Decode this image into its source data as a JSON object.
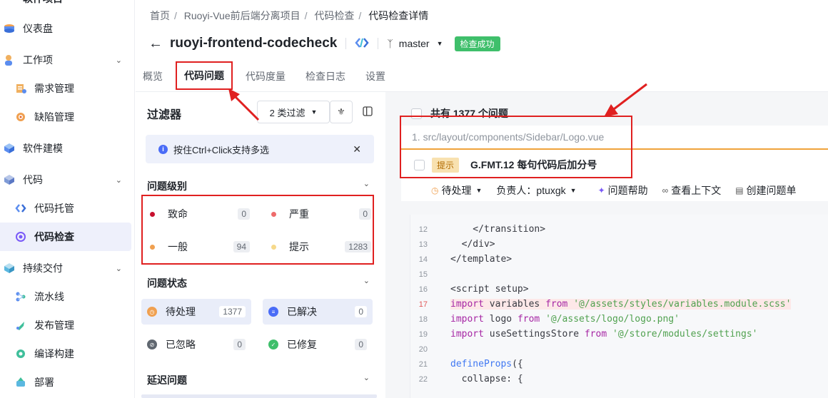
{
  "sidebar": {
    "top_partial": "软件项目",
    "items": [
      {
        "label": "仪表盘",
        "icon": "dashboard-icon"
      },
      {
        "label": "工作项",
        "icon": "workitem-icon"
      },
      {
        "label": "需求管理",
        "icon": "requirement-icon"
      },
      {
        "label": "缺陷管理",
        "icon": "bug-icon"
      },
      {
        "label": "软件建模",
        "icon": "model-icon"
      },
      {
        "label": "代码",
        "icon": "code-icon"
      },
      {
        "label": "代码托管",
        "icon": "repo-icon"
      },
      {
        "label": "代码检查",
        "icon": "codecheck-icon"
      },
      {
        "label": "持续交付",
        "icon": "delivery-icon"
      },
      {
        "label": "流水线",
        "icon": "pipeline-icon"
      },
      {
        "label": "发布管理",
        "icon": "release-icon"
      },
      {
        "label": "编译构建",
        "icon": "build-icon"
      },
      {
        "label": "部署",
        "icon": "deploy-icon"
      }
    ]
  },
  "breadcrumb": [
    "首页",
    "Ruoyi-Vue前后端分离项目",
    "代码检查",
    "代码检查详情"
  ],
  "header": {
    "project_name": "ruoyi-frontend-codecheck",
    "branch": "master",
    "status_badge": "检查成功"
  },
  "tabs": [
    "概览",
    "代码问题",
    "代码度量",
    "检查日志",
    "设置"
  ],
  "filter": {
    "title": "过滤器",
    "filter_button": "2 类过滤",
    "tip": "按住Ctrl+Click支持多选",
    "level_section": "问题级别",
    "levels": [
      {
        "label": "致命",
        "count": "0",
        "color": "#c8102e"
      },
      {
        "label": "严重",
        "count": "0",
        "color": "#ee6b6b"
      },
      {
        "label": "一般",
        "count": "94",
        "color": "#f0a050"
      },
      {
        "label": "提示",
        "count": "1283",
        "color": "#f6d98b"
      }
    ],
    "status_section": "问题状态",
    "statuses": [
      {
        "label": "待处理",
        "count": "1377",
        "color": "#f0a050"
      },
      {
        "label": "已解决",
        "count": "0",
        "color": "#4a6cf7"
      },
      {
        "label": "已忽略",
        "count": "0",
        "color": "#606770"
      },
      {
        "label": "已修复",
        "count": "0",
        "color": "#3fbf6b"
      }
    ],
    "delayed_section": "延迟问题"
  },
  "issues": {
    "total": "共有 1377 个问题",
    "file": "1. src/layout/components/Sidebar/Logo.vue",
    "tag": "提示",
    "rule": "G.FMT.12 每句代码后加分号",
    "status": "待处理",
    "assignee": "负责人：ptuxgk",
    "help": "问题帮助",
    "context": "查看上下文",
    "create": "创建问题单"
  },
  "code": [
    {
      "n": "12",
      "t": "    </transition>"
    },
    {
      "n": "13",
      "t": "  </div>"
    },
    {
      "n": "14",
      "t": "</template>"
    },
    {
      "n": "15",
      "t": ""
    },
    {
      "n": "16",
      "t": "<script setup>"
    },
    {
      "n": "17",
      "t": "import variables from '@/assets/styles/variables.module.scss'",
      "hl": true
    },
    {
      "n": "18",
      "t": "import logo from '@/assets/logo/logo.png'"
    },
    {
      "n": "19",
      "t": "import useSettingsStore from '@/store/modules/settings'"
    },
    {
      "n": "20",
      "t": ""
    },
    {
      "n": "21",
      "t": "defineProps({"
    },
    {
      "n": "22",
      "t": "  collapse: {"
    }
  ]
}
